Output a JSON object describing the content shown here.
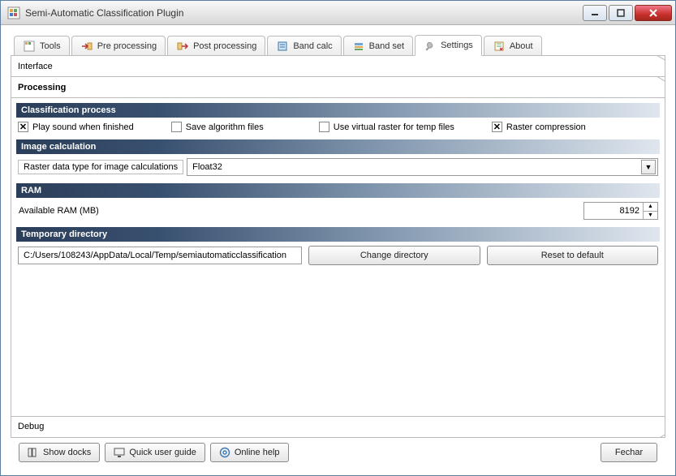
{
  "window": {
    "title": "Semi-Automatic Classification Plugin"
  },
  "tabs": [
    {
      "label": "Tools"
    },
    {
      "label": "Pre processing"
    },
    {
      "label": "Post processing"
    },
    {
      "label": "Band calc"
    },
    {
      "label": "Band set"
    },
    {
      "label": "Settings"
    },
    {
      "label": "About"
    }
  ],
  "sidetabs": {
    "interface": "Interface",
    "processing": "Processing",
    "debug": "Debug"
  },
  "sections": {
    "classification": {
      "header": "Classification process",
      "play_sound": "Play sound when finished",
      "save_algo": "Save algorithm files",
      "use_virtual": "Use virtual raster for temp files",
      "raster_comp": "Raster compression"
    },
    "imgcalc": {
      "header": "Image calculation",
      "label": "Raster data type for image calculations",
      "value": "Float32"
    },
    "ram": {
      "header": "RAM",
      "label": "Available RAM (MB)",
      "value": "8192"
    },
    "tempdir": {
      "header": "Temporary directory",
      "path": "C:/Users/108243/AppData/Local/Temp/semiautomaticclassification",
      "change": "Change directory",
      "reset": "Reset to default"
    }
  },
  "footer": {
    "show_docks": "Show docks",
    "quick_guide": "Quick user guide",
    "online_help": "Online help",
    "close": "Fechar"
  }
}
